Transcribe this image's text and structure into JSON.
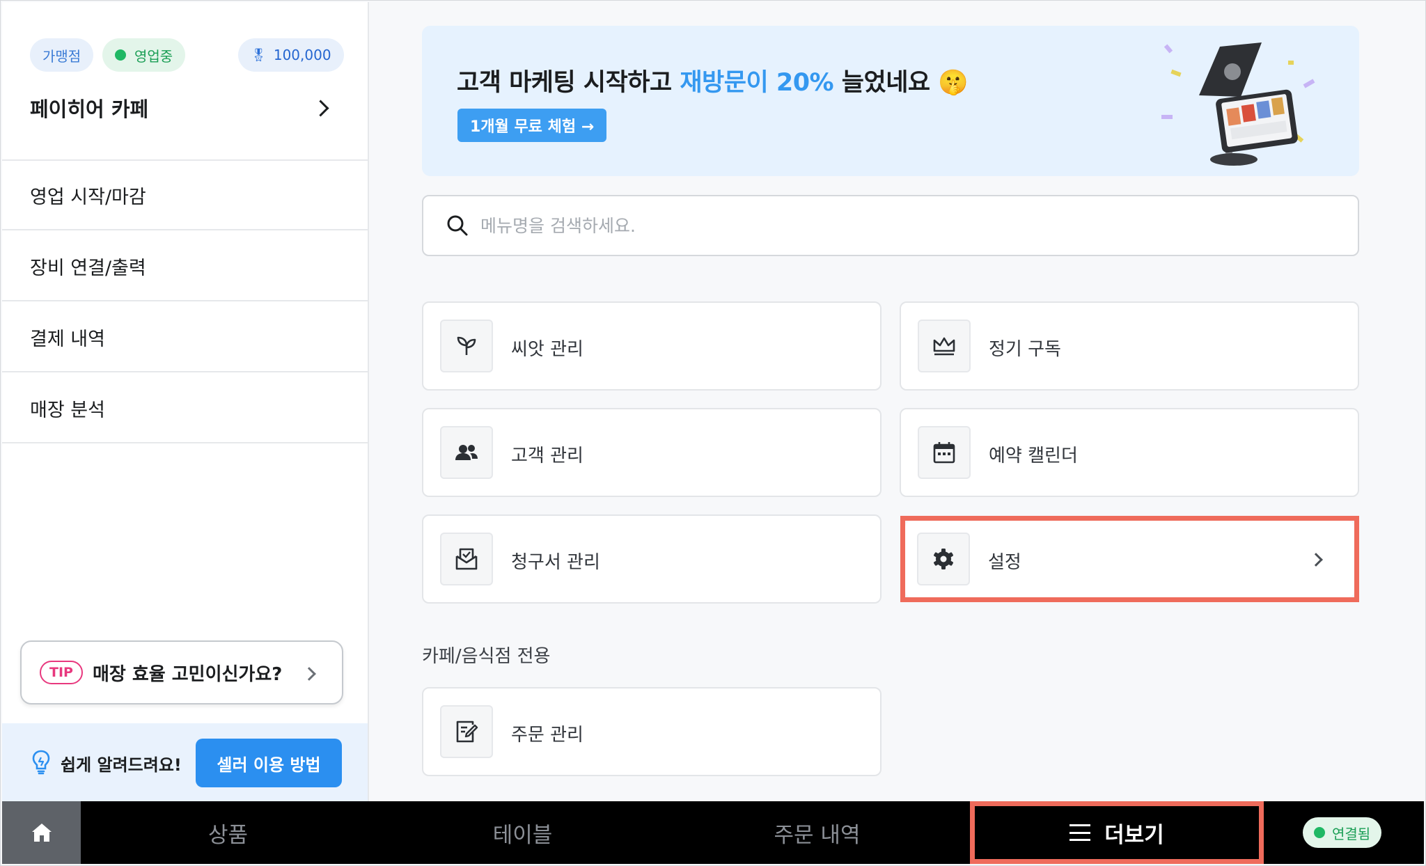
{
  "sidebar": {
    "badges": {
      "franchise": "가맹점",
      "open": "영업중",
      "points": "100,000"
    },
    "store_name": "페이히어 카페",
    "items": [
      {
        "label": "영업 시작/마감"
      },
      {
        "label": "장비 연결/출력"
      },
      {
        "label": "결제 내역"
      },
      {
        "label": "매장 분석"
      }
    ],
    "tip": {
      "badge": "TIP",
      "text": "매장 효율 고민이신가요?"
    },
    "help": {
      "text": "쉽게 알려드려요!",
      "button": "셀러 이용 방법"
    }
  },
  "banner": {
    "title_before": "고객 마케팅 시작하고 ",
    "title_accent": "재방문이 20%",
    "title_after": " 늘었네요 🤫",
    "cta": "1개월 무료 체험 →"
  },
  "search": {
    "placeholder": "메뉴명을 검색하세요."
  },
  "menu_cards": [
    {
      "label": "씨앗 관리",
      "icon": "sprout-icon"
    },
    {
      "label": "정기 구독",
      "icon": "crown-icon"
    },
    {
      "label": "고객 관리",
      "icon": "people-icon"
    },
    {
      "label": "예약 캘린더",
      "icon": "calendar-icon"
    },
    {
      "label": "청구서 관리",
      "icon": "invoice-mail-icon"
    },
    {
      "label": "설정",
      "icon": "gear-icon"
    }
  ],
  "cafe_section": {
    "title": "카페/음식점 전용",
    "cards": [
      {
        "label": "주문 관리",
        "icon": "order-edit-icon"
      }
    ]
  },
  "bottom_nav": {
    "tabs": [
      {
        "label": "상품"
      },
      {
        "label": "테이블"
      },
      {
        "label": "주문 내역"
      },
      {
        "label": "더보기"
      }
    ],
    "status": "연결됨"
  },
  "colors": {
    "accent_blue": "#3498f0",
    "highlight_red": "#ef6b5b",
    "status_green": "#1fb864"
  }
}
